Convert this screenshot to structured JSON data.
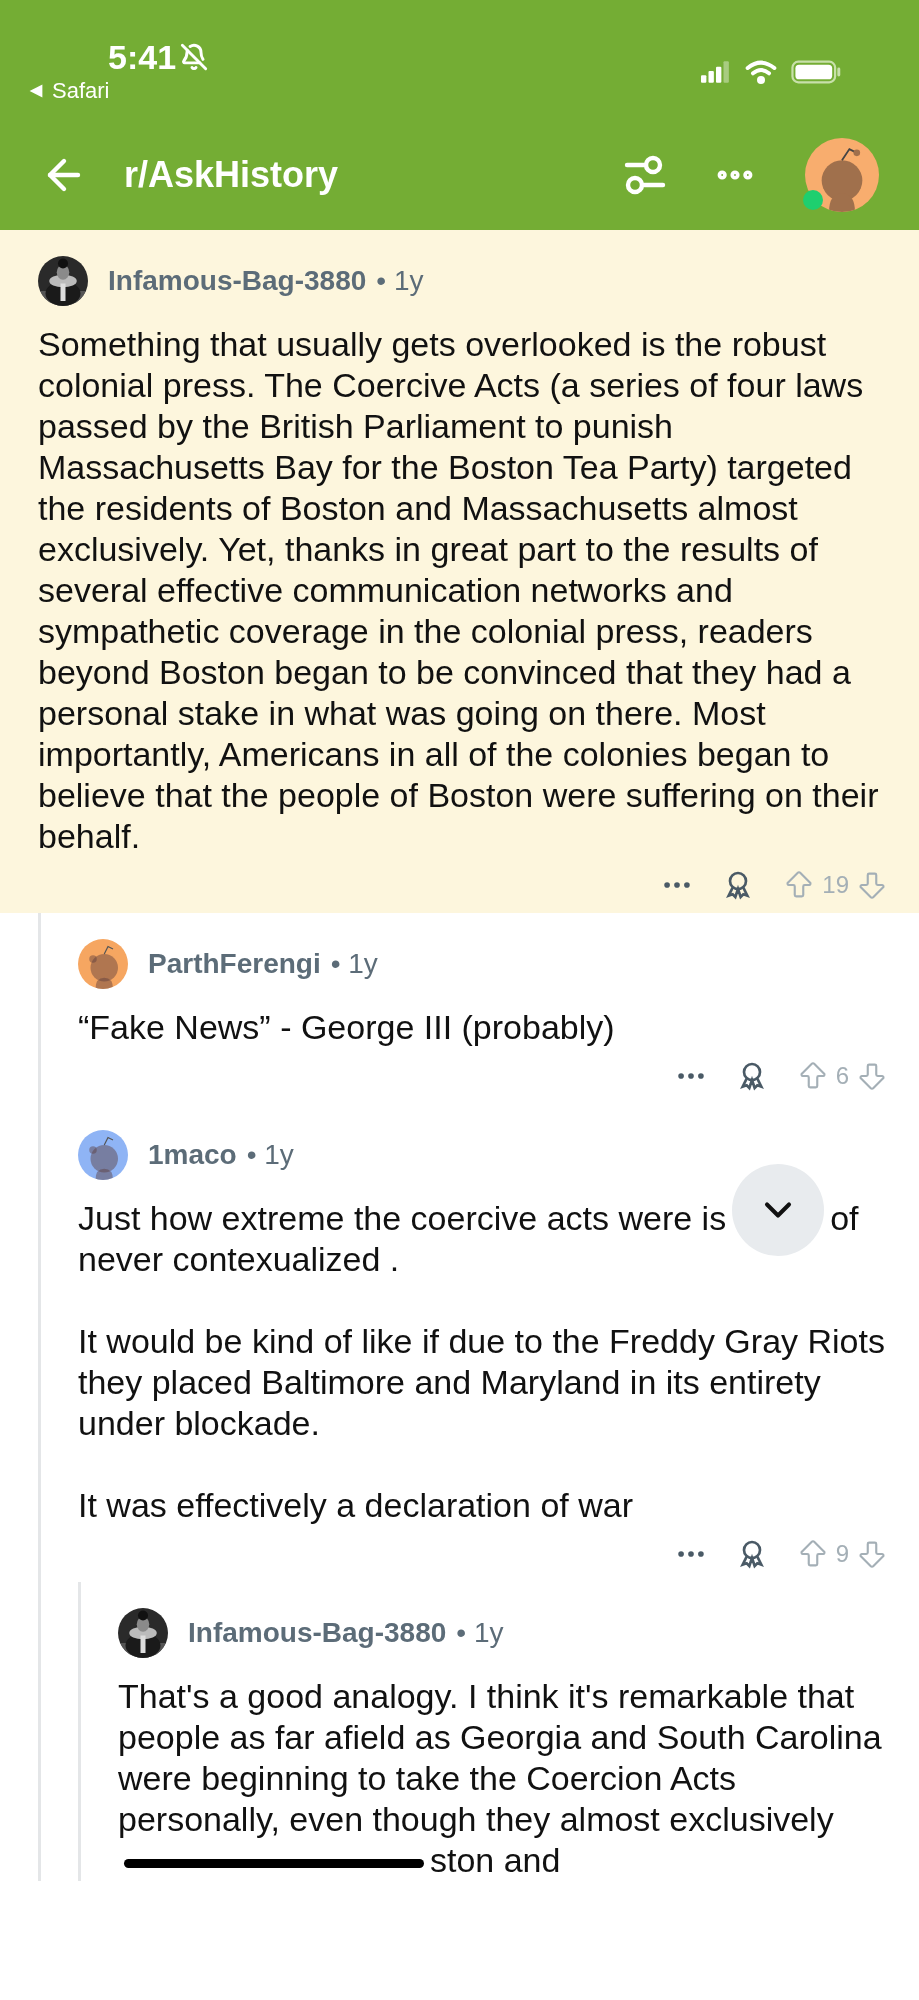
{
  "status_bar": {
    "time": "5:41",
    "back_app": "Safari"
  },
  "nav": {
    "title": "r/AskHistory"
  },
  "comments": [
    {
      "author": "Infamous-Bag-3880",
      "age": "• 1y",
      "avatar": {
        "kind": "picture"
      },
      "highlighted": true,
      "paragraphs": [
        {
          "kind": "text",
          "text": "Something that usually gets overlooked is the robust colonial press. The Coercive Acts (a series of four laws passed by the British Parliament to punish Massachusetts Bay for the Boston Tea Party) targeted the residents of Boston and Massachusetts almost exclusively. Yet, thanks in great part to the results of several effective communication networks and sympathetic coverage in the colonial press, readers beyond Boston began to be convinced that they had a personal stake in what was going on there. Most importantly, Americans in all of the colonies began to believe that the people of Boston were suffering on their behalf."
        }
      ],
      "score": "19",
      "children": [
        {
          "author": "ParthFerengi",
          "age": "• 1y",
          "avatar": {
            "kind": "snoo",
            "color": "#f6a661"
          },
          "highlighted": false,
          "paragraphs": [
            {
              "kind": "text",
              "text": "“Fake News” - George III (probably)"
            }
          ],
          "score": "6"
        },
        {
          "author": "1maco",
          "age": "• 1y",
          "avatar": {
            "kind": "snoo",
            "color": "#8fb4f5"
          },
          "highlighted": false,
          "paragraphs": [
            {
              "kind": "covered",
              "before": "Just how extreme the coercive acts were is",
              "after": "of",
              "next_line": "never contexualized ."
            },
            {
              "kind": "text",
              "text": "It would be kind of like if due to the Freddy Gray Riots they placed Baltimore and Maryland in its entirety under blockade."
            },
            {
              "kind": "text",
              "text": "It was effectively a declaration of war"
            }
          ],
          "score": "9",
          "children": [
            {
              "author": "Infamous-Bag-3880",
              "age": "• 1y",
              "avatar": {
                "kind": "picture"
              },
              "highlighted": false,
              "paragraphs": [
                {
                  "kind": "redacted",
                  "before": "That's a good analogy. I think it's remarkable that people as far afield as Georgia and South Carolina were beginning to take the Coercion Acts personally, even though they almost exclusively",
                  "after": "ston and"
                }
              ]
            }
          ]
        }
      ]
    }
  ]
}
